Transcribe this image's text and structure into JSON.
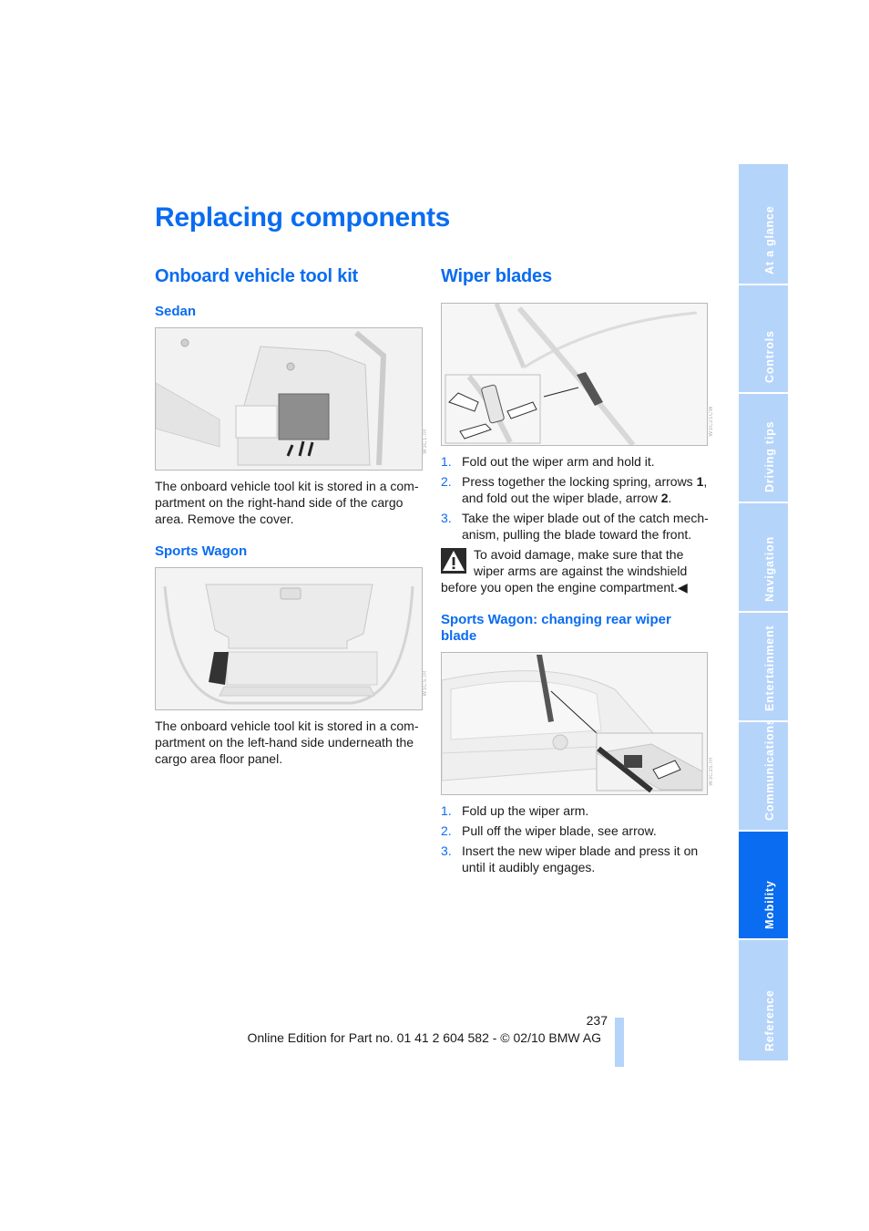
{
  "page_title": "Replacing components",
  "left_column": {
    "heading": "Onboard vehicle tool kit",
    "sedan": {
      "subheading": "Sedan",
      "figure_name": "sedan-trunk-tool-compartment",
      "text": "The onboard vehicle tool kit is stored in a com-partment on the right-hand side of the cargo area. Remove the cover."
    },
    "wagon": {
      "subheading": "Sports Wagon",
      "figure_name": "wagon-cargo-area",
      "text": "The onboard vehicle tool kit is stored in a com-partment on the left-hand side underneath the cargo area floor panel."
    }
  },
  "right_column": {
    "heading": "Wiper blades",
    "steps": [
      {
        "num": "1.",
        "text": "Fold out the wiper arm and hold it."
      },
      {
        "num": "2.",
        "pre": "Press together the locking spring, arrows ",
        "b1": "1",
        "mid": ", and fold out the wiper blade, arrow ",
        "b2": "2",
        "post": "."
      },
      {
        "num": "3.",
        "text": "Take the wiper blade out of the catch mech-anism, pulling the blade toward the front."
      }
    ],
    "warning": {
      "icon": "warning-triangle-icon",
      "text": "To avoid damage, make sure that the wiper arms are against the windshield before you open the engine compartment.",
      "end_mark": "◀"
    },
    "rear": {
      "subheading": "Sports Wagon: changing rear wiper blade",
      "steps": [
        {
          "num": "1.",
          "text": "Fold up the wiper arm."
        },
        {
          "num": "2.",
          "text": "Pull off the wiper blade, see arrow."
        },
        {
          "num": "3.",
          "text": "Insert the new wiper blade and press it on until it audibly engages."
        }
      ]
    }
  },
  "side_tabs": [
    {
      "label": "At a glance",
      "active": false
    },
    {
      "label": "Controls",
      "active": false
    },
    {
      "label": "Driving tips",
      "active": false
    },
    {
      "label": "Navigation",
      "active": false
    },
    {
      "label": "Entertainment",
      "active": false
    },
    {
      "label": "Communications",
      "active": false
    },
    {
      "label": "Mobility",
      "active": true
    },
    {
      "label": "Reference",
      "active": false
    }
  ],
  "footer": {
    "page_number": "237",
    "text": "Online Edition for Part no. 01 41 2 604 582 - © 02/10 BMW AG"
  },
  "colors": {
    "accent": "#0a6cf0",
    "tab_inactive": "#b5d4fa"
  }
}
